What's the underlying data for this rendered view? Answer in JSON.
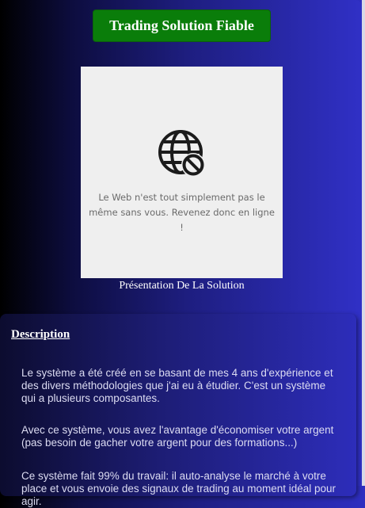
{
  "header": {
    "button_label": "Trading Solution Fiable"
  },
  "embed": {
    "icon": "globe-blocked-icon",
    "message": "Le Web n'est tout simplement pas le même sans vous. Revenez donc en ligne !",
    "caption": "Présentation De La Solution"
  },
  "description": {
    "title": "Description",
    "paragraphs": [
      "Le système a été créé en se basant de mes 4 ans d'expérience et des divers méthodologies que j'ai eu à étudier. C'est un système qui a plusieurs composantes.",
      "Avec ce système, vous avez l'avantage d'économiser votre argent (pas besoin de gacher votre argent pour des formations...)",
      "Ce système fait 99% du travail: il auto-analyse le marché à votre place et vous envoie des signaux de trading au moment idéal pour agir."
    ]
  },
  "colors": {
    "button_bg": "#0a7d0a",
    "accent_blue": "#2e2ec0"
  }
}
